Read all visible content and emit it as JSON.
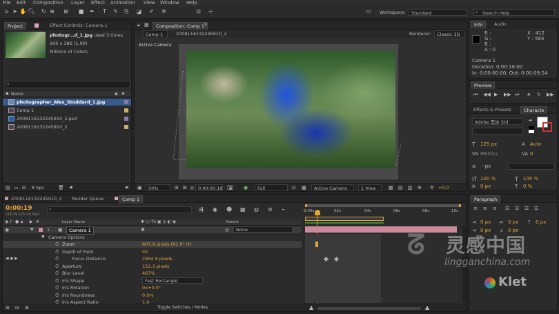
{
  "menu": [
    "File",
    "Edit",
    "Composition",
    "Layer",
    "Effect",
    "Animation",
    "View",
    "Window",
    "Help"
  ],
  "toolbar": {
    "workspace_label": "Workspace:",
    "workspace_value": "Standard",
    "search_placeholder": "Search Help"
  },
  "project": {
    "tab_project": "Project",
    "tab_effect_controls": "Effect Controls: Camera 1",
    "file_name": "photogr...d_1.jpg",
    "used_count": ", used 3 times",
    "dimensions": "600 x 386 (1.00)",
    "colors": "Millions of Colors",
    "search_placeholder": "",
    "col_name": "Name",
    "items": [
      {
        "name": "photographer_Alex_Stoddard_1.jpg",
        "selected": true,
        "icon": "image-icon"
      },
      {
        "name": "Comp 1",
        "selected": false,
        "icon": "composition-icon"
      },
      {
        "name": "2008116132245910_2.psd",
        "selected": false,
        "icon": "psd-icon"
      },
      {
        "name": "2008116132245910_2",
        "selected": false,
        "icon": "composition-icon"
      }
    ],
    "bpc": "8 bpc"
  },
  "composition": {
    "tab": "Composition: Comp 1",
    "nav_comp": "Comp 1",
    "nav_path": "2008116132245910_2",
    "renderer_label": "Renderer:",
    "renderer_value": "Classic 3D",
    "view_label": "Active Camera",
    "zoom": "50%",
    "timecode": "0:00:00:19",
    "resolution": "Full",
    "camera": "Active Camera",
    "views": "1 View",
    "exposure": "+0.0"
  },
  "info": {
    "tab_info": "Info",
    "tab_audio": "Audio",
    "r": "R :",
    "g": "G :",
    "b": "B :",
    "a": "A : 0",
    "x": "X : 412",
    "y": "Y : 584",
    "camera_name": "Camera 1",
    "duration": "Duration: 0:00:10:00",
    "in_out": "In: 0:00:00:00, Out: 0:00:09:24"
  },
  "preview": {
    "tab": "Preview"
  },
  "effects": {
    "tab_effects": "Effects & Presets",
    "tab_character": "Characte"
  },
  "character": {
    "font": "Adobe 黑体 Std",
    "style": "-",
    "size": "125 px",
    "size_auto": "Auto",
    "leading": "px",
    "metrics": "Metrics",
    "tracking": "0",
    "stroke": "- px",
    "scale_v": "100 %",
    "scale_h": "100 %",
    "baseline": "0 px",
    "tsume": "0 %"
  },
  "paragraph": {
    "tab": "Paragraph",
    "indent_l": "0 px",
    "indent_r": "0 px",
    "space_b": "0 px",
    "indent_f": "0 px",
    "space_a": "0 px"
  },
  "timeline": {
    "tabs": [
      "2008116132245910_2",
      "Render Queue",
      "Comp 1"
    ],
    "timecode": "0:00:19",
    "frames": "00019 (25.00 fps)",
    "col_layer": "Layer Name",
    "col_parent": "Parent",
    "layer_num": "1",
    "layer_name": "Camera 1",
    "parent_value": "None",
    "group": "Camera Options",
    "properties": [
      {
        "name": "Zoom",
        "value": "807.9 pixels (61.9° H)",
        "highlight": true
      },
      {
        "name": "Depth of Field",
        "value": "On",
        "highlight": false
      },
      {
        "name": "Focus Distance",
        "value": "2954.9 pixels",
        "highlight": false
      },
      {
        "name": "Aperture",
        "value": "152.3 pixels",
        "highlight": false
      },
      {
        "name": "Blur Level",
        "value": "467%",
        "highlight": false
      },
      {
        "name": "Iris Shape",
        "value": "Fast Rectangle",
        "highlight": false
      },
      {
        "name": "Iris Rotation",
        "value": "0x+0.0°",
        "highlight": false
      },
      {
        "name": "Iris Roundness",
        "value": "0.0%",
        "highlight": false
      },
      {
        "name": "Iris Aspect Ratio",
        "value": "1.0",
        "highlight": false
      }
    ],
    "ruler_labels": [
      "0:00s",
      "02s",
      "04s",
      "06s",
      "08s",
      "10s"
    ],
    "toggle_label": "Toggle Switches / Modes"
  },
  "watermark": {
    "cn": "灵感中国",
    "url": "lingganchina.com",
    "klet": "Klet"
  },
  "colors": {
    "accent": "#e0a43a",
    "selection": "#3a5a8c",
    "layer_bar": "#c98b9a",
    "comp_bg": "#4a4a4a"
  }
}
